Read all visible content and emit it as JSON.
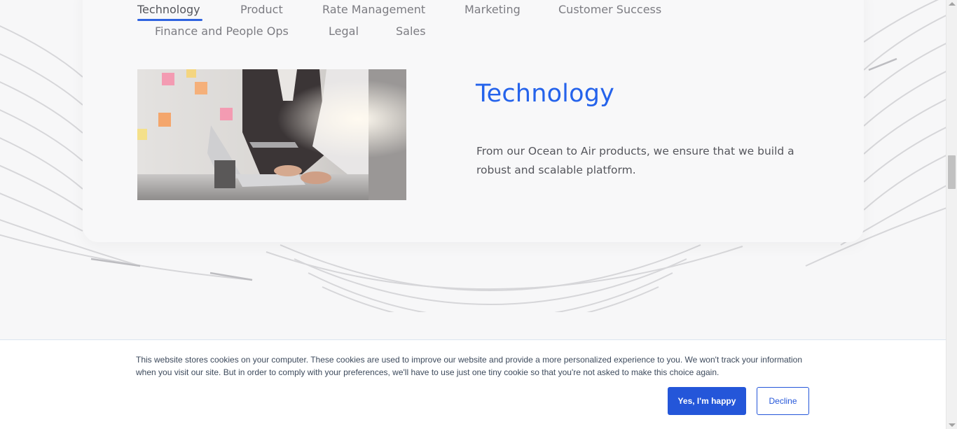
{
  "tabs": {
    "items": [
      {
        "label": "Technology",
        "active": true
      },
      {
        "label": "Product",
        "active": false
      },
      {
        "label": "Rate Management",
        "active": false
      },
      {
        "label": "Marketing",
        "active": false
      },
      {
        "label": "Customer Success",
        "active": false
      },
      {
        "label": "Finance and People Ops",
        "active": false
      },
      {
        "label": "Legal",
        "active": false
      },
      {
        "label": "Sales",
        "active": false
      }
    ]
  },
  "section": {
    "title": "Technology",
    "description": "From our Ocean to Air products, we ensure that we build a robust and scalable platform."
  },
  "cookie_banner": {
    "text": "This website stores cookies on your computer. These cookies are used to improve our website and provide a more personalized experience to you. We won't track your information when you visit our site. But in order to comply with your preferences, we'll have to use just one tiny cookie so that you're not asked to make this choice again.",
    "accept_label": "Yes, I'm happy",
    "decline_label": "Decline"
  },
  "colors": {
    "accent": "#2563eb",
    "button_primary": "#2456d9",
    "tab_text": "#7c7c82",
    "body_text": "#55565c"
  }
}
